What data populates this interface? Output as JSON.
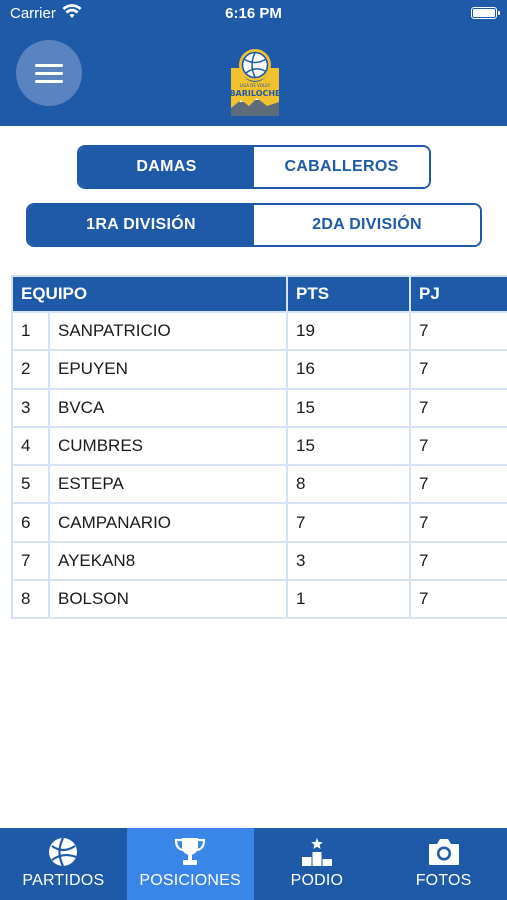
{
  "status_bar": {
    "carrier": "Carrier",
    "time": "6:16 PM"
  },
  "header": {
    "logo_text_top": "LIGA DE VOLEY",
    "logo_text_main": "BARILOCHE",
    "menu_icon": "hamburger-menu-icon"
  },
  "gender_toggle": {
    "options": [
      "DAMAS",
      "CABALLEROS"
    ],
    "selected": "DAMAS"
  },
  "division_toggle": {
    "options": [
      "1RA DIVISIÓN",
      "2DA DIVISIÓN"
    ],
    "selected": "1RA DIVISIÓN"
  },
  "standings": {
    "headers": {
      "team": "EQUIPO",
      "pts": "PTS",
      "pj": "PJ"
    },
    "rows": [
      {
        "pos": "1",
        "team": "SANPATRICIO",
        "pts": "19",
        "pj": "7"
      },
      {
        "pos": "2",
        "team": "EPUYEN",
        "pts": "16",
        "pj": "7"
      },
      {
        "pos": "3",
        "team": "BVCA",
        "pts": "15",
        "pj": "7"
      },
      {
        "pos": "4",
        "team": "CUMBRES",
        "pts": "15",
        "pj": "7"
      },
      {
        "pos": "5",
        "team": "ESTEPA",
        "pts": "8",
        "pj": "7"
      },
      {
        "pos": "6",
        "team": "CAMPANARIO",
        "pts": "7",
        "pj": "7"
      },
      {
        "pos": "7",
        "team": "AYEKAN8",
        "pts": "3",
        "pj": "7"
      },
      {
        "pos": "8",
        "team": "BOLSON",
        "pts": "1",
        "pj": "7"
      }
    ]
  },
  "tabbar": {
    "tabs": [
      {
        "label": "PARTIDOS",
        "icon": "volleyball-icon"
      },
      {
        "label": "POSICIONES",
        "icon": "trophy-icon"
      },
      {
        "label": "PODIO",
        "icon": "podium-icon"
      },
      {
        "label": "FOTOS",
        "icon": "camera-icon"
      }
    ],
    "active": "POSICIONES"
  },
  "colors": {
    "primary": "#1f5aa8",
    "active_tab": "#3a85e8",
    "grid": "#d6e3f5",
    "logo_yellow": "#f2c12e"
  }
}
